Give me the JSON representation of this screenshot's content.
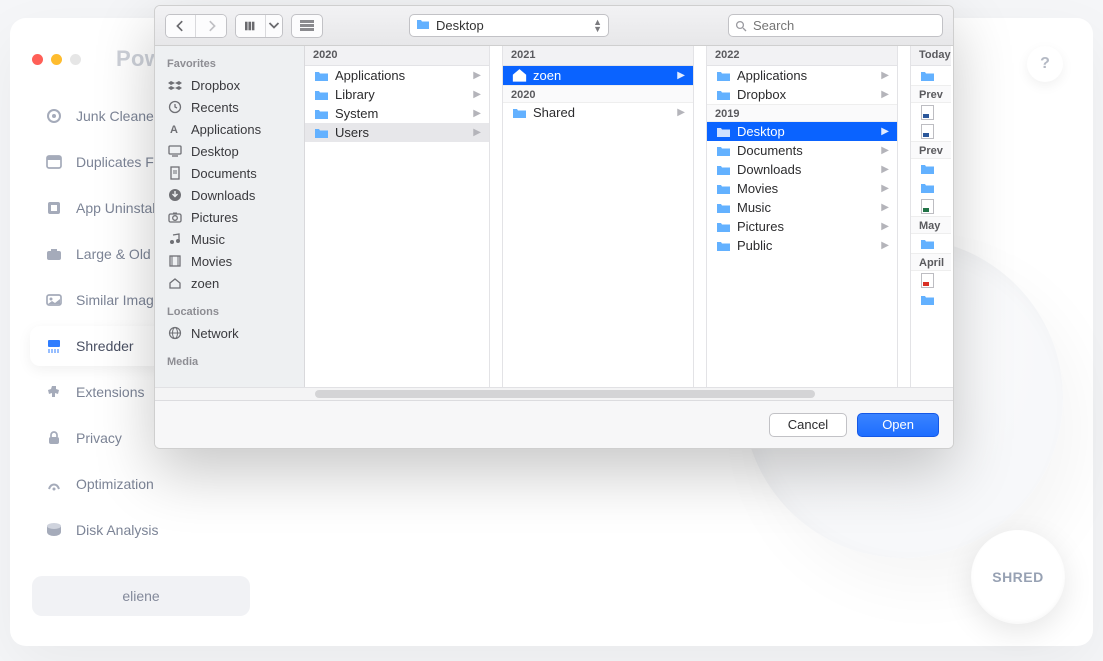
{
  "app": {
    "title": "Powe",
    "sidebar_items": [
      {
        "label": "Junk Cleaner"
      },
      {
        "label": "Duplicates Finder"
      },
      {
        "label": "App Uninstaller"
      },
      {
        "label": "Large & Old Files"
      },
      {
        "label": "Similar Image Finder"
      },
      {
        "label": "Shredder",
        "selected": true
      },
      {
        "label": "Extensions"
      },
      {
        "label": "Privacy"
      },
      {
        "label": "Optimization"
      },
      {
        "label": "Disk Analysis"
      }
    ],
    "user": "eliene",
    "help": "?",
    "shred": "SHRED"
  },
  "finder": {
    "path_folder": "Desktop",
    "search_placeholder": "Search",
    "sidebar": {
      "favorites_label": "Favorites",
      "favorites": [
        {
          "label": "Dropbox",
          "icon": "dropbox"
        },
        {
          "label": "Recents",
          "icon": "clock"
        },
        {
          "label": "Applications",
          "icon": "apps"
        },
        {
          "label": "Desktop",
          "icon": "desktop"
        },
        {
          "label": "Documents",
          "icon": "doc"
        },
        {
          "label": "Downloads",
          "icon": "download"
        },
        {
          "label": "Pictures",
          "icon": "camera"
        },
        {
          "label": "Music",
          "icon": "music"
        },
        {
          "label": "Movies",
          "icon": "film"
        },
        {
          "label": "zoen",
          "icon": "home"
        }
      ],
      "locations_label": "Locations",
      "locations": [
        {
          "label": "Network",
          "icon": "globe"
        }
      ],
      "media_label": "Media"
    },
    "columns": [
      {
        "header": "2020",
        "items": [
          {
            "label": "Applications",
            "kind": "folder",
            "arrow": true
          },
          {
            "label": "Library",
            "kind": "folder",
            "arrow": true
          },
          {
            "label": "System",
            "kind": "folder",
            "arrow": true
          },
          {
            "label": "Users",
            "kind": "folder",
            "arrow": true,
            "soft": true
          }
        ]
      },
      {
        "header": "2021",
        "items": [
          {
            "label": "zoen",
            "kind": "home",
            "arrow": true,
            "selected": true
          }
        ],
        "groups": [
          {
            "header": "2020",
            "items": [
              {
                "label": "Shared",
                "kind": "folder",
                "arrow": true
              }
            ]
          }
        ]
      },
      {
        "header": "2022",
        "items": [
          {
            "label": "Applications",
            "kind": "folder",
            "arrow": true
          },
          {
            "label": "Dropbox",
            "kind": "folder",
            "arrow": true
          }
        ],
        "groups": [
          {
            "header": "2019",
            "items": [
              {
                "label": "Desktop",
                "kind": "folder",
                "arrow": true,
                "selected": true
              },
              {
                "label": "Documents",
                "kind": "folder",
                "arrow": true
              },
              {
                "label": "Downloads",
                "kind": "folder",
                "arrow": true
              },
              {
                "label": "Movies",
                "kind": "folder",
                "arrow": true
              },
              {
                "label": "Music",
                "kind": "folder",
                "arrow": true
              },
              {
                "label": "Pictures",
                "kind": "folder",
                "arrow": true
              },
              {
                "label": "Public",
                "kind": "folder",
                "arrow": true
              }
            ]
          }
        ]
      },
      {
        "header": "Today",
        "items": [
          {
            "label": "",
            "kind": "folder"
          }
        ],
        "groups": [
          {
            "header": "Prev",
            "items": [
              {
                "label": "",
                "kind": "worddoc"
              },
              {
                "label": "",
                "kind": "worddoc"
              }
            ]
          },
          {
            "header": "Prev",
            "items": [
              {
                "label": "",
                "kind": "folder"
              },
              {
                "label": "",
                "kind": "folder"
              },
              {
                "label": "",
                "kind": "xlsdoc"
              }
            ]
          },
          {
            "header": "May",
            "items": [
              {
                "label": "",
                "kind": "folder"
              }
            ]
          },
          {
            "header": "April",
            "items": [
              {
                "label": "",
                "kind": "pdfdoc"
              },
              {
                "label": "",
                "kind": "folder"
              }
            ]
          }
        ]
      }
    ],
    "buttons": {
      "cancel": "Cancel",
      "open": "Open"
    }
  }
}
